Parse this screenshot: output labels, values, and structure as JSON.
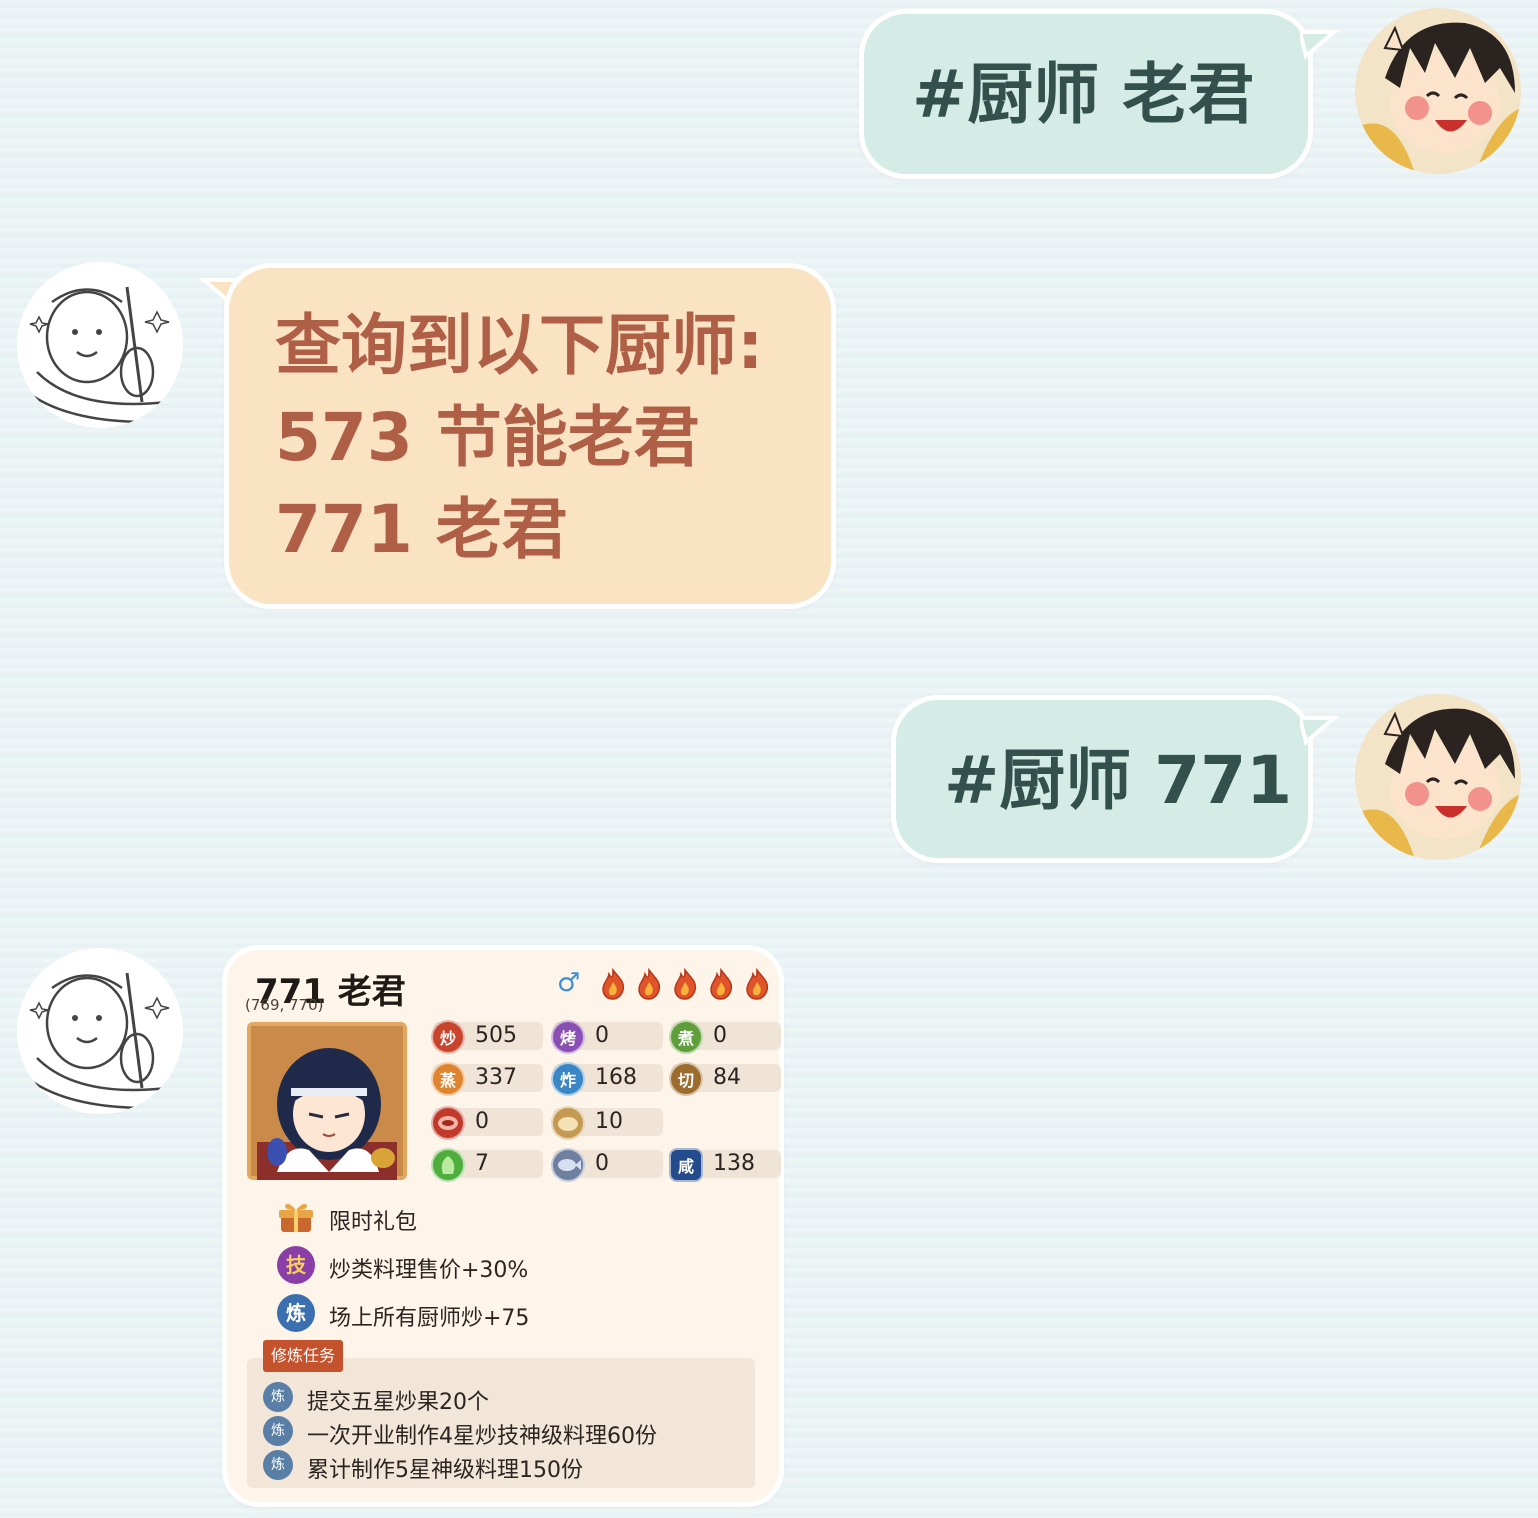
{
  "messages": [
    {
      "role": "user",
      "text": "#厨师 老君"
    },
    {
      "role": "bot",
      "lines": [
        "查询到以下厨师:",
        "573 节能老君",
        "771 老君"
      ]
    },
    {
      "role": "user",
      "text": "#厨师 771"
    }
  ],
  "chef_card": {
    "title": "771 老君",
    "subtitle": "(769, 770)",
    "gender_symbol": "♂",
    "rarity_flames": 5,
    "stats": [
      {
        "icon": "炒",
        "name": "stir-fry",
        "value": "505",
        "color": "#c9442c"
      },
      {
        "icon": "烤",
        "name": "roast",
        "value": "0",
        "color": "#8a4fb3"
      },
      {
        "icon": "煮",
        "name": "boil",
        "value": "0",
        "color": "#5f9e3a"
      },
      {
        "icon": "蒸",
        "name": "steam",
        "value": "337",
        "color": "#e0852f"
      },
      {
        "icon": "炸",
        "name": "fry",
        "value": "168",
        "color": "#3b86c4"
      },
      {
        "icon": "切",
        "name": "cut",
        "value": "84",
        "color": "#9c6b2e"
      },
      {
        "icon": "",
        "name": "meat",
        "value": "0",
        "color": "#c0392b"
      },
      {
        "icon": "",
        "name": "flour",
        "value": "10",
        "color": "#c49a52"
      },
      {
        "icon": "",
        "name": "vegetable",
        "value": "7",
        "color": "#4fae3d"
      },
      {
        "icon": "",
        "name": "fish",
        "value": "0",
        "color": "#6f7fa0"
      },
      {
        "icon": "咸",
        "name": "salty",
        "value": "138",
        "color": "#244b8c"
      }
    ],
    "source": {
      "icon": "gift-box",
      "text": "限时礼包"
    },
    "skill": {
      "icon": "技",
      "text": "炒类料理售价+30%",
      "color": "#8a3fa8"
    },
    "ultimate": {
      "icon": "炼",
      "text": "场上所有厨师炒+75",
      "color": "#3c6fb0"
    },
    "task_title": "修炼任务",
    "tasks": [
      {
        "icon": "炼",
        "text": "提交五星炒果20个"
      },
      {
        "icon": "炼",
        "text": "一次开业制作4星炒技神级料理60份"
      },
      {
        "icon": "炼",
        "text": "累计制作5星神级料理150份"
      }
    ]
  }
}
